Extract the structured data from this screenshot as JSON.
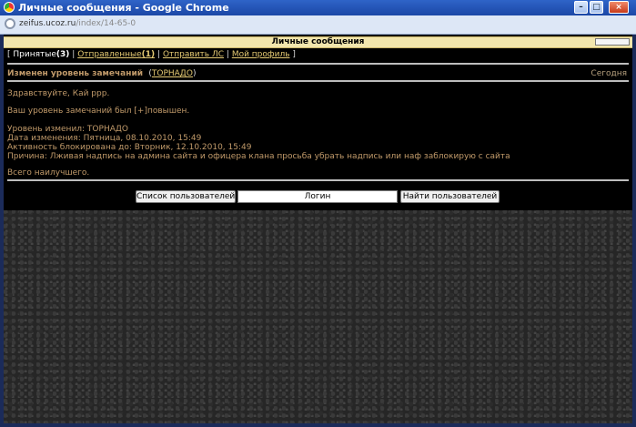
{
  "window": {
    "title": "Личные сообщения - Google Chrome",
    "minimize": "–",
    "maximize": "□",
    "close": "×"
  },
  "address": {
    "host": "zeifus.ucoz.ru",
    "path": "/index/14-65-0"
  },
  "panel": {
    "header": "Личные сообщения"
  },
  "nav": {
    "open_bracket": "[",
    "received_label": "Принятые",
    "received_count": "(3)",
    "sent_label": "Отправленные",
    "sent_count": "(1)",
    "compose_label": "Отправить ЛС",
    "profile_label": "Мой профиль",
    "pipe": "|",
    "close_bracket": "]"
  },
  "message": {
    "subject": "Изменен уровень замечаний",
    "from_open": "(",
    "from_name": "ТОРНАДО",
    "from_close": ")",
    "date": "Сегодня",
    "body": [
      "Здравствуйте, Кай ррр.",
      "Ваш уровень замечаний был [+]повышен.",
      "Уровень изменил: ТОРНАДО",
      "Дата изменения: Пятница, 08.10.2010, 15:49",
      "Активность блокирована до: Вторник, 12.10.2010, 15:49",
      "Причина: Лживая надпись на админа сайта и офицера клана просьба убрать надпись или наф заблокирую с сайта",
      "Всего наилучшего."
    ]
  },
  "actions": {
    "users_list": "Список пользователей",
    "login_value": "Логин",
    "find_users": "Найти пользователей"
  }
}
